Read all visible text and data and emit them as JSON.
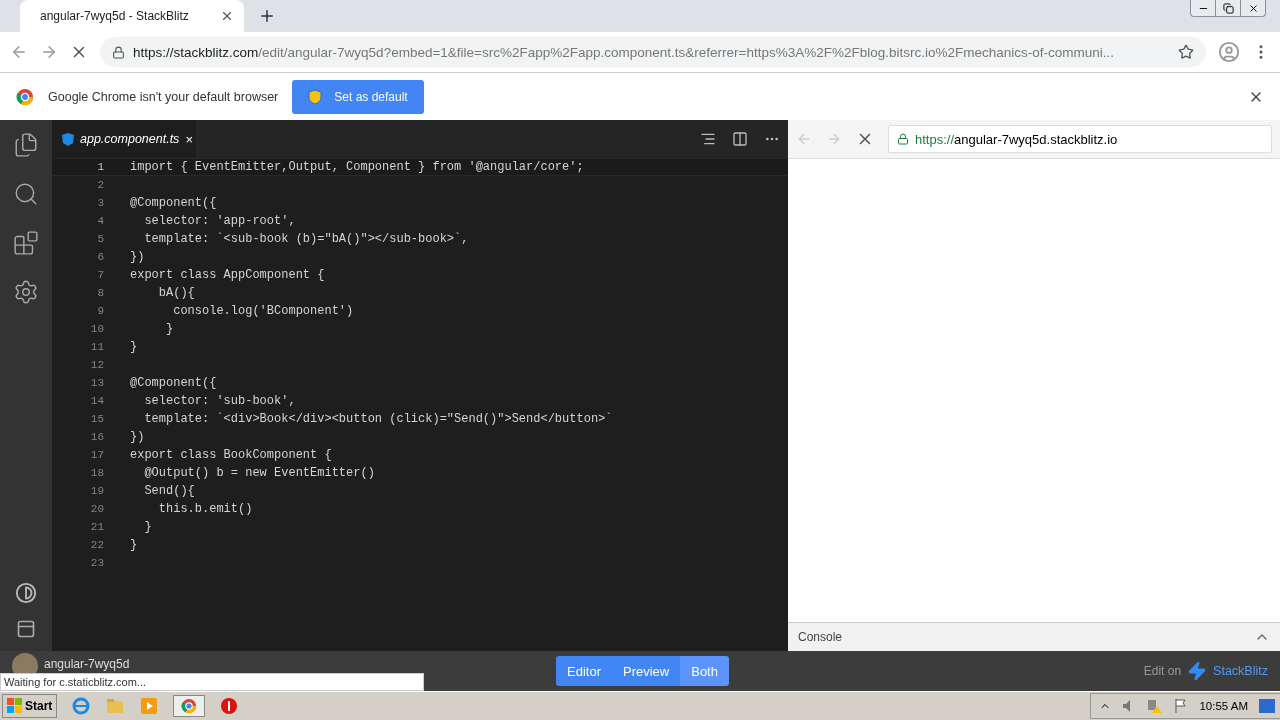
{
  "browser": {
    "tab_title": "angular-7wyq5d - StackBlitz",
    "url_host": "https://stackblitz.com",
    "url_rest": "/edit/angular-7wyq5d?embed=1&file=src%2Fapp%2Fapp.component.ts&referrer=https%3A%2F%2Fblog.bitsrc.io%2Fmechanics-of-communi...",
    "infobar_text": "Google Chrome isn't your default browser",
    "infobar_button": "Set as default"
  },
  "editor": {
    "tab": "app.component.ts",
    "close": "×",
    "lines": [
      {
        "number": "1",
        "code": "import { EventEmitter,Output, Component } from '@angular/core';",
        "current": true
      },
      {
        "number": "2",
        "current": false
      },
      {
        "number": "3",
        "code": "@Component({",
        "current": false
      },
      {
        "number": "4",
        "code": "  selector: 'app-root',",
        "current": false
      },
      {
        "number": "5",
        "code": "  template: `<sub-book (b)=\"bA()\"></sub-book>`,",
        "current": false
      },
      {
        "number": "6",
        "code": "})",
        "current": false
      },
      {
        "number": "7",
        "code": "export class AppComponent {",
        "current": false
      },
      {
        "number": "8",
        "code": "    bA(){",
        "current": false
      },
      {
        "number": "9",
        "code": "      console.log('BComponent')",
        "current": false
      },
      {
        "number": "10",
        "code": "     }",
        "current": false
      },
      {
        "number": "11",
        "code": "}",
        "current": false
      },
      {
        "number": "12",
        "current": false
      },
      {
        "number": "13",
        "code": "@Component({",
        "current": false
      },
      {
        "number": "14",
        "code": "  selector: 'sub-book',",
        "current": false
      },
      {
        "number": "15",
        "code": "  template: `<div>Book</div><button (click)=\"Send()\">Send</button>`",
        "current": false
      },
      {
        "number": "16",
        "code": "})",
        "current": false
      },
      {
        "number": "17",
        "code": "export class BookComponent {",
        "current": false
      },
      {
        "number": "18",
        "code": "  @Output() b = new EventEmitter()",
        "current": false
      },
      {
        "number": "19",
        "code": "  Send(){",
        "current": false
      },
      {
        "number": "20",
        "code": "    this.b.emit()",
        "current": false
      },
      {
        "number": "21",
        "code": "  }",
        "current": false
      },
      {
        "number": "22",
        "code": "}",
        "current": false
      },
      {
        "number": "23",
        "current": false
      }
    ]
  },
  "preview": {
    "url_scheme": "https://",
    "url_host": "angular-7wyq5d.stackblitz.io",
    "console": "Console"
  },
  "bottom_bar": {
    "project": "angular-7wyq5d",
    "views": [
      {
        "label": "Editor",
        "selected": false
      },
      {
        "label": "Preview",
        "selected": false
      },
      {
        "label": "Both",
        "selected": true
      }
    ],
    "edit_on": "Edit on",
    "brand": "StackBlitz"
  },
  "status_bubble": "Waiting for c.staticblitz.com...",
  "taskbar": {
    "start": "Start",
    "clock": "10:55 AM"
  }
}
